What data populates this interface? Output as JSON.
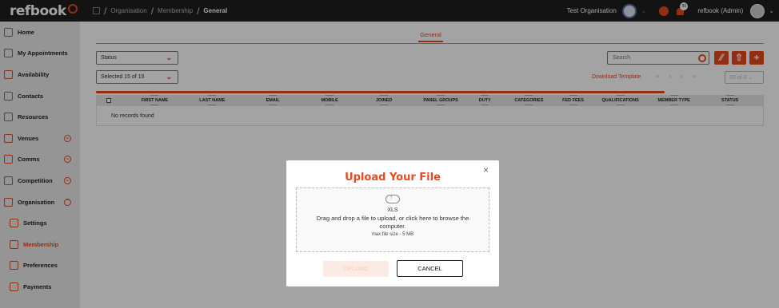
{
  "app": {
    "logo_text": "refbook"
  },
  "breadcrumb": {
    "sep": "/",
    "items": [
      "Organisation",
      "Membership",
      "General"
    ]
  },
  "header": {
    "org_name": "Test Organisation",
    "notification_count": "50",
    "user_name": "refbook (Admin)"
  },
  "sidebar": {
    "items": [
      {
        "label": "Home",
        "icon": "home-icon"
      },
      {
        "label": "My Appointments",
        "icon": "appointments-icon"
      },
      {
        "label": "Availability",
        "icon": "calendar-icon"
      },
      {
        "label": "Contacts",
        "icon": "contacts-icon"
      },
      {
        "label": "Resources",
        "icon": "resources-icon"
      },
      {
        "label": "Venues",
        "icon": "venues-icon",
        "expandable": true
      },
      {
        "label": "Comms",
        "icon": "comms-icon",
        "expandable": true
      },
      {
        "label": "Competition",
        "icon": "competition-icon",
        "expandable": true
      },
      {
        "label": "Organisation",
        "icon": "organisation-icon",
        "expandable": true
      },
      {
        "label": "Settings",
        "icon": "settings-icon",
        "sub": true
      },
      {
        "label": "Membership",
        "icon": "membership-icon",
        "sub": true,
        "active": true
      },
      {
        "label": "Preferences",
        "icon": "preferences-icon",
        "sub": true
      },
      {
        "label": "Payments",
        "icon": "payments-icon",
        "sub": true
      }
    ]
  },
  "main": {
    "tab": "General",
    "status_filter": "Status",
    "selected_filter": "Selected 15 of 15",
    "search_placeholder": "Search",
    "download_template": "Download Template",
    "pager": {
      "first": "«",
      "prev": "‹",
      "next": "›",
      "last": "»"
    },
    "page_size": "20 of 0",
    "columns": [
      "FIRST NAME",
      "LAST NAME",
      "EMAIL",
      "MOBILE",
      "JOINED",
      "PANEL GROUPS",
      "DUTY",
      "CATEGORIES",
      "FED FEES",
      "QUALIFICATIONS",
      "MEMBER TYPE",
      "STATUS"
    ],
    "no_records": "No records found"
  },
  "modal": {
    "title": "Upload Your File",
    "close": "×",
    "file_type": "XLS",
    "instructions": "Drag and drop a file to upload, or click here to browse the computer.",
    "max_size": "max file size - 5 MB",
    "upload_label": "UPLOAD",
    "cancel_label": "CANCEL"
  },
  "colors": {
    "accent": "#e8491d",
    "topbar": "#1f1f1f",
    "sidebar": "#e9e9e9"
  }
}
